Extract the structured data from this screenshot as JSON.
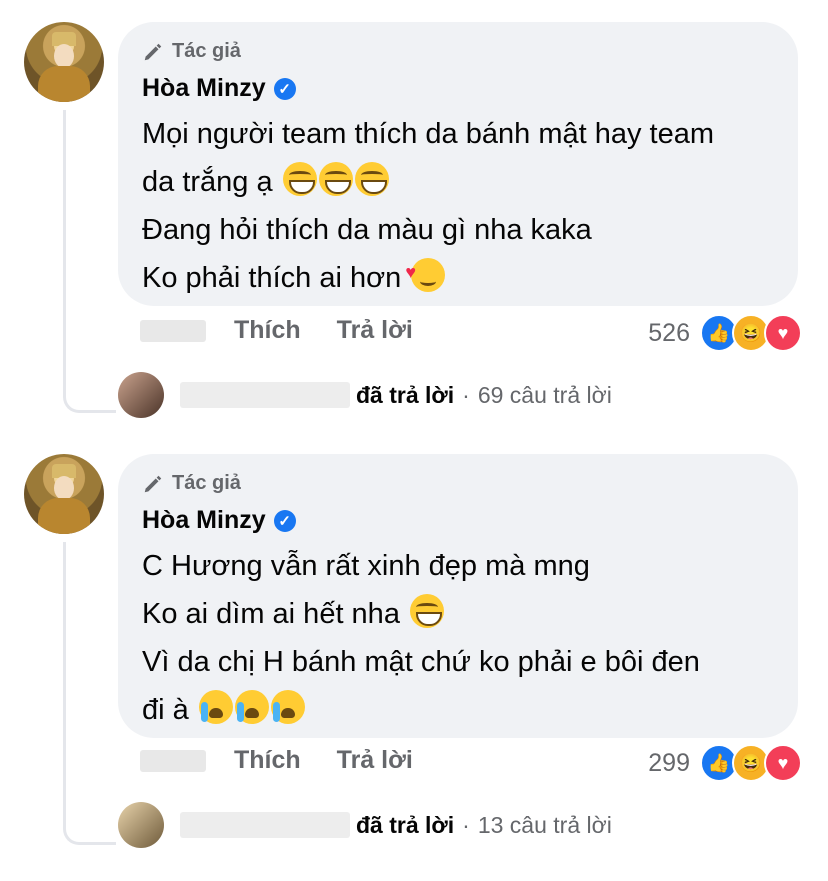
{
  "comments": [
    {
      "badge": "Tác giả",
      "author": "Hòa Minzy",
      "lines": [
        {
          "text": "Mọi người team thích da bánh mật hay team",
          "emojis": []
        },
        {
          "text": "da trắng ạ",
          "emojis": [
            "grin",
            "grin",
            "grin"
          ]
        },
        {
          "text": "Đang hỏi thích da màu gì nha kaka",
          "emojis": []
        },
        {
          "text": "Ko phải thích ai hơn",
          "emojis": [
            "love"
          ]
        }
      ],
      "like_label": "Thích",
      "reply_label": "Trả lời",
      "reaction_count": "526",
      "reply_summary": {
        "action": "đã trả lời",
        "count": "69 câu trả lời"
      }
    },
    {
      "badge": "Tác giả",
      "author": "Hòa Minzy",
      "lines": [
        {
          "text": "C Hương vẫn rất xinh đẹp mà mng",
          "emojis": []
        },
        {
          "text": "Ko ai dìm ai hết nha",
          "emojis": [
            "grin"
          ]
        },
        {
          "text": "Vì da chị H bánh mật chứ ko phải e bôi đen",
          "emojis": []
        },
        {
          "text": "đi à",
          "emojis": [
            "cry",
            "cry",
            "cry"
          ]
        }
      ],
      "like_label": "Thích",
      "reply_label": "Trả lời",
      "reaction_count": "299",
      "reply_summary": {
        "action": "đã trả lời",
        "count": "13 câu trả lời"
      }
    }
  ],
  "icons": {
    "author_badge": "pen-icon",
    "verified": "verified-icon",
    "reactions": [
      "like-reaction-icon",
      "haha-reaction-icon",
      "love-reaction-icon"
    ]
  },
  "colors": {
    "bubble": "#f0f2f5",
    "secondary_text": "#65676b",
    "verified": "#1877f2"
  }
}
